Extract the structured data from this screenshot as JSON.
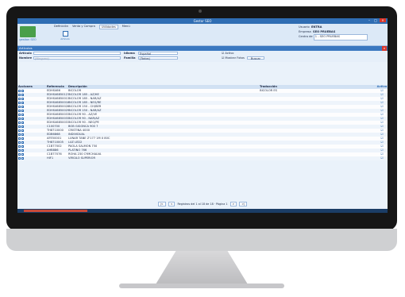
{
  "window": {
    "title": "Gestor SEO",
    "btn_minimize": "–",
    "btn_maximize": "□",
    "btn_close": "×"
  },
  "ribbon": {
    "logo_text": "gestion SEO",
    "menus": [
      "Definición",
      "Venta y Compra",
      "Utilidades",
      "Menú"
    ],
    "active_menu_index": 2,
    "tool_label": "Artículo",
    "user_label": "Usuario",
    "user_value": "ENTRA",
    "company_label": "Empresa",
    "company_value": "SEO PRUEBAS",
    "workplace_label": "Centro de",
    "workplace_value": "1 - SEO PRUEBAS"
  },
  "section": {
    "title": "Artículos",
    "close": "×"
  },
  "filters": {
    "articulo_label": "Artículo",
    "nombre_label": "Nombre",
    "nombre_placeholder": "(Ninguno)",
    "idioma_label": "Idioma",
    "idioma_value": "Español",
    "familia_label": "Familia",
    "familia_value": "(Todos)",
    "activo_label": "Activo",
    "mostrar_fotos_label": "Mostrar Fotos",
    "buscar_label": "Buscar"
  },
  "table": {
    "headers": [
      "Acciones",
      "Referencia",
      "Descripción",
      "Traducción",
      "Activo"
    ],
    "rows": [
      {
        "ref": "EDHS466",
        "desc": "BICOLOR",
        "trans": "BICOLOR ES",
        "activo": "☑"
      },
      {
        "ref": "EDHS46850127",
        "desc": "BICOLOR 185 - AZ/HE",
        "trans": "",
        "activo": "☑"
      },
      {
        "ref": "EDHS46850013",
        "desc": "BICOLOR 185 - NAR/AZ",
        "trans": "",
        "activo": "☑"
      },
      {
        "ref": "EDHS46850018",
        "desc": "BICOLOR 185 - NEG/RE",
        "trans": "",
        "activo": "☑"
      },
      {
        "ref": "EDHS46850028",
        "desc": "BICOLOR 150 - CH/BER",
        "trans": "",
        "activo": "☑"
      },
      {
        "ref": "EDHS46850029",
        "desc": "BICOLOR 150 - NAR/AZ",
        "trans": "",
        "activo": "☑"
      },
      {
        "ref": "EDHS46850037",
        "desc": "BICOLOR 90 - AZ/VE",
        "trans": "",
        "activo": "☑"
      },
      {
        "ref": "EDHS46850033",
        "desc": "BICOLOR 90 - NAR/AZ",
        "trans": "",
        "activo": "☑"
      },
      {
        "ref": "EDHS46850031",
        "desc": "BICOLOR 90 - NEG/PE",
        "trans": "",
        "activo": "☑"
      },
      {
        "ref": "C100700",
        "desc": "BOB GIGONCA 900 7",
        "trans": "",
        "activo": "☑"
      },
      {
        "ref": "TH8710000",
        "desc": "CRISTINA 4000",
        "trans": "",
        "activo": "☑"
      },
      {
        "ref": "EDB6868",
        "desc": "INDIVIDUAL",
        "trans": "",
        "activo": "☑"
      },
      {
        "ref": "AFE50001",
        "desc": "LUNAR TANE Z'177 1M X 80C",
        "trans": "",
        "activo": "☑"
      },
      {
        "ref": "TH8710005",
        "desc": "LUZ LED2",
        "trans": "",
        "activo": "☑"
      },
      {
        "ref": "C1B77002",
        "desc": "PAOLA SALMON 750",
        "trans": "",
        "activo": "☑"
      },
      {
        "ref": "AHB886",
        "desc": "PLATINO 766",
        "trans": "",
        "activo": "☑"
      },
      {
        "ref": "C1B77076",
        "desc": "ROHA 230 CYMCHALVA",
        "trans": "",
        "activo": "☑"
      },
      {
        "ref": "HIF1",
        "desc": "VIRGILO SUPERIOR",
        "trans": "",
        "activo": "☑"
      }
    ]
  },
  "pager": {
    "first": "|<",
    "prev": "<",
    "info": "Registros del 1 al 18 de 18 · Página 1",
    "next": ">",
    "last": ">|"
  },
  "colors": {
    "titlebar": "#2f6db3",
    "ribbon": "#dce9f7",
    "section": "#3a78c0",
    "close": "#d9362b"
  }
}
